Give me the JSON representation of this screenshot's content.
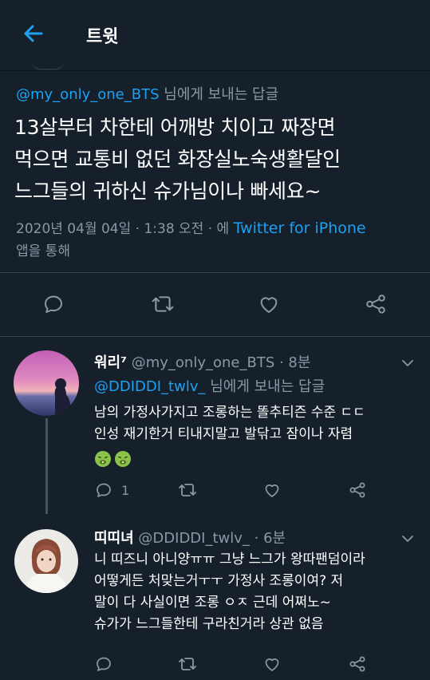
{
  "header": {
    "title": "트윗"
  },
  "main_tweet": {
    "reply_handle": "@my_only_one_BTS",
    "reply_suffix": " 님에게 보내는 답글",
    "text_lines": [
      "13살부터 차한테 어깨방 치이고 짜장면",
      "먹으면 교통비 없던 화장실노숙생활달인",
      "느그들의 귀하신 슈가님이나 빠세요~"
    ],
    "meta_date": "2020년 04월 04일 · 1:38 오전 · 에 ",
    "meta_source": "Twitter for iPhone",
    "meta_suffix": "앱을 통해"
  },
  "reply1": {
    "name": "워리⁷",
    "handle": " @my_only_one_BTS",
    "time": " · 8분",
    "reply_handle": "@DDIDDI_twlv_",
    "reply_suffix": " 님에게 보내는 답글",
    "text_lines": [
      "남의 가정사가지고 조롱하는 똘추티즌 수준 ㄷㄷ",
      "인성 재기한거 티내지말고 발닦고 잠이나 자렴"
    ],
    "reply_count": "1"
  },
  "reply2": {
    "name": "띠띠녀",
    "handle": " @DDIDDI_twlv_",
    "time": " · 6분",
    "text_lines": [
      "니 띠즈니 아니양ㅠㅠ 그냥 느그가 왕따팬덤이라",
      "어떻게든 처맞는거ㅜㅜ 가정사 조롱이여? 저",
      "말이 다 사실이면 조롱 ㅇㅈ 근데 어쩌노~",
      "슈가가 느그들한테 구라친거라 상관 없음"
    ]
  },
  "colors": {
    "background": "#15202b",
    "accent": "#1da1f2",
    "secondary_text": "#8899a6",
    "divider": "#38444d"
  },
  "icons": [
    "back-arrow-icon",
    "reply-icon",
    "retweet-icon",
    "like-icon",
    "share-icon",
    "chevron-down-icon",
    "nauseated-emoji-icon"
  ]
}
